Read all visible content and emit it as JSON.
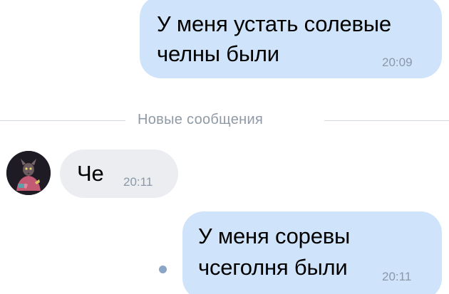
{
  "messages": [
    {
      "direction": "outgoing",
      "lines": [
        "У меня устать солевые",
        "челны были"
      ],
      "time": "20:09"
    },
    {
      "direction": "incoming",
      "lines": [
        "Че"
      ],
      "time": "20:11"
    },
    {
      "direction": "outgoing",
      "lines": [
        "У меня соревы",
        "чсеголня были"
      ],
      "time": "20:11",
      "unread": true
    }
  ],
  "divider": {
    "label": "Новые сообщения"
  },
  "colors": {
    "outgoing_bubble": "#cfe3fa",
    "incoming_bubble": "#ebedf0",
    "timestamp": "#8b98a8",
    "divider_text": "#8f9aa6",
    "unread_dot": "#8ba5c4"
  }
}
